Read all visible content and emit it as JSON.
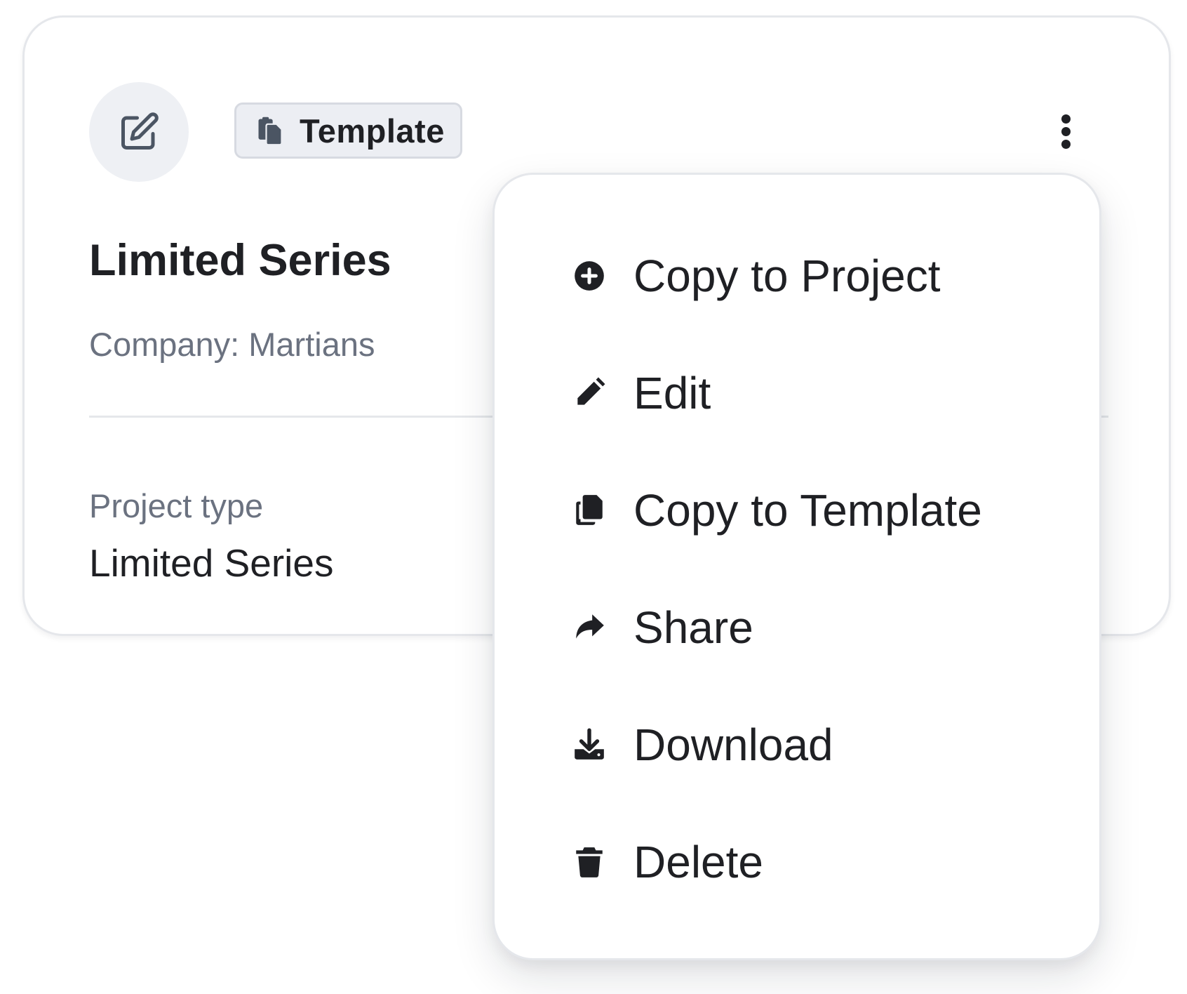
{
  "card": {
    "badge_label": "Template",
    "title": "Limited Series",
    "company": "Company: Martians",
    "project_type_label": "Project type",
    "project_type_value": "Limited Series"
  },
  "menu": {
    "items": [
      {
        "label": "Copy to Project",
        "icon": "plus-circle-icon"
      },
      {
        "label": "Edit",
        "icon": "pencil-icon"
      },
      {
        "label": "Copy to Template",
        "icon": "copy-icon"
      },
      {
        "label": "Share",
        "icon": "share-icon"
      },
      {
        "label": "Download",
        "icon": "download-icon"
      },
      {
        "label": "Delete",
        "icon": "trash-icon"
      }
    ]
  },
  "colors": {
    "text_primary": "#1f2024",
    "text_muted": "#6b7280",
    "border": "#e5e7eb",
    "avatar_bg": "#eef0f4",
    "badge_bg": "#eceef3"
  }
}
